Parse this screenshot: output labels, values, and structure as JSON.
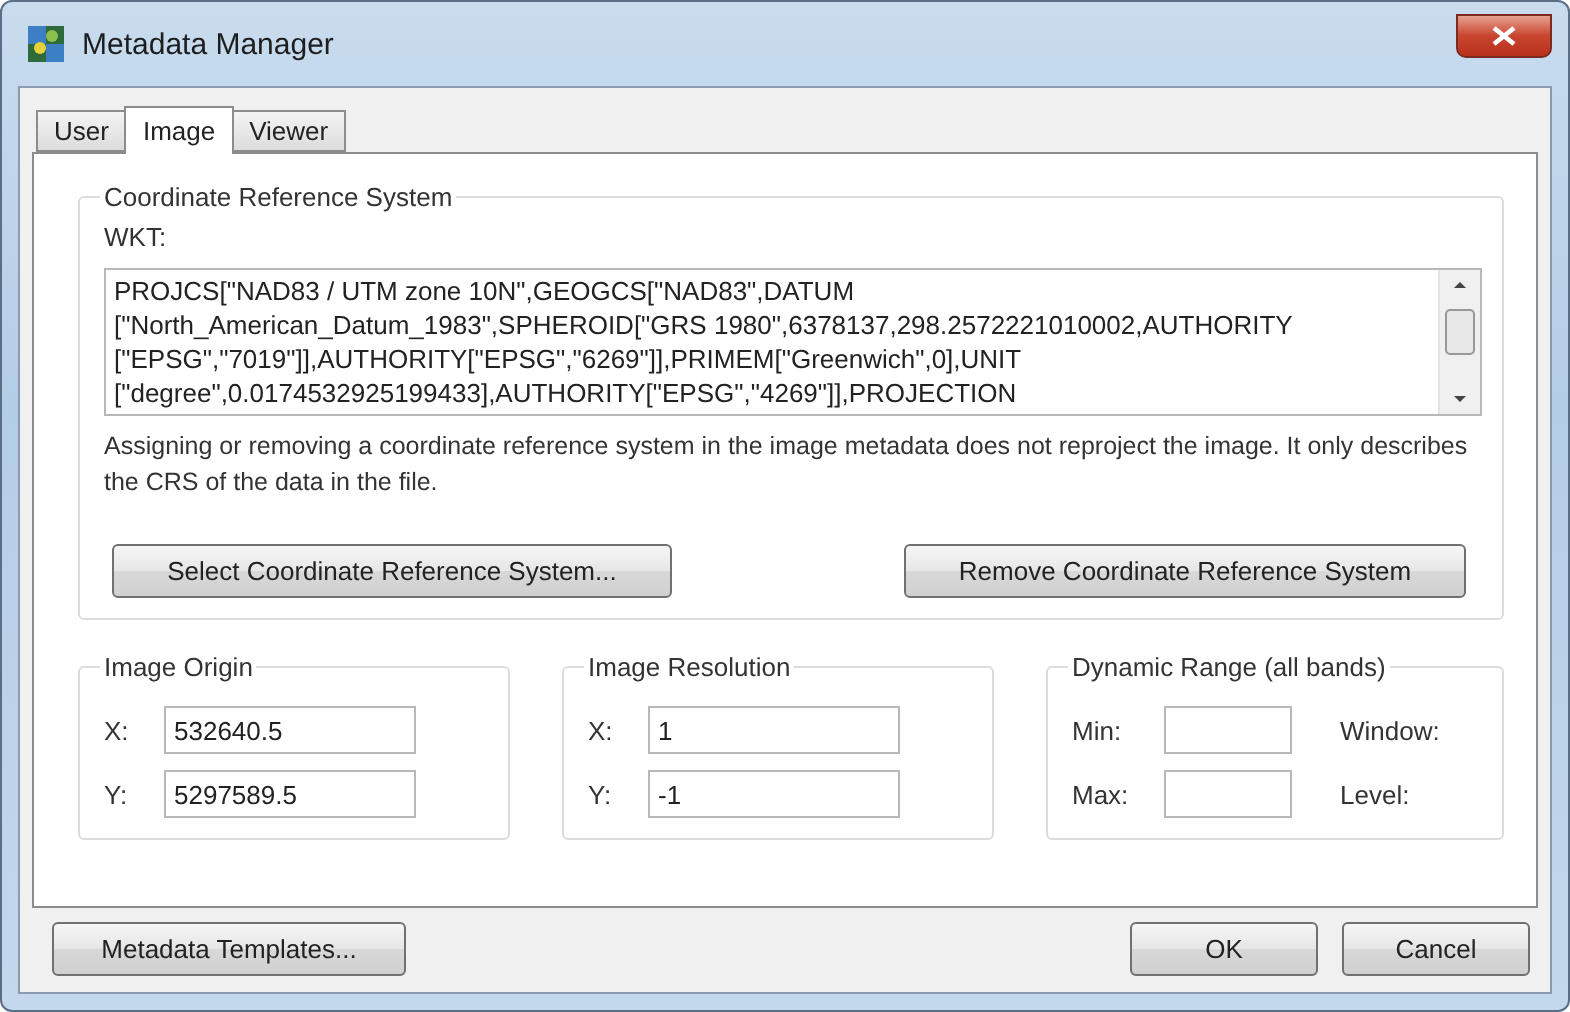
{
  "window": {
    "title": "Metadata Manager"
  },
  "tabs": [
    {
      "label": "User",
      "selected": false
    },
    {
      "label": "Image",
      "selected": true
    },
    {
      "label": "Viewer",
      "selected": false
    }
  ],
  "crs": {
    "title": "Coordinate Reference System",
    "wkt_label": "WKT:",
    "wkt": "PROJCS[\"NAD83 / UTM zone 10N\",GEOGCS[\"NAD83\",DATUM\n[\"North_American_Datum_1983\",SPHEROID[\"GRS 1980\",6378137,298.2572221010002,AUTHORITY\n[\"EPSG\",\"7019\"]],AUTHORITY[\"EPSG\",\"6269\"]],PRIMEM[\"Greenwich\",0],UNIT\n[\"degree\",0.0174532925199433],AUTHORITY[\"EPSG\",\"4269\"]],PROJECTION",
    "note": "Assigning or removing a coordinate reference system in the image metadata does not reproject the image.  It only describes the CRS of the data in the file.",
    "buttons": [
      "Select Coordinate Reference System...",
      "Remove Coordinate Reference System"
    ]
  },
  "image_origin": {
    "title": "Image Origin",
    "fields": [
      {
        "label": "X:",
        "value": "532640.5"
      },
      {
        "label": "Y:",
        "value": "5297589.5"
      }
    ]
  },
  "image_resolution": {
    "title": "Image Resolution",
    "fields": [
      {
        "label": "X:",
        "value": "1"
      },
      {
        "label": "Y:",
        "value": "-1"
      }
    ]
  },
  "dynamic_range": {
    "title": "Dynamic Range (all bands)",
    "rows": [
      {
        "label": "Min:",
        "side_label": "Window:"
      },
      {
        "label": "Max:",
        "side_label": "Level:"
      }
    ]
  },
  "footer": {
    "templates_button": "Metadata Templates...",
    "ok_button": "OK",
    "cancel_button": "Cancel"
  }
}
